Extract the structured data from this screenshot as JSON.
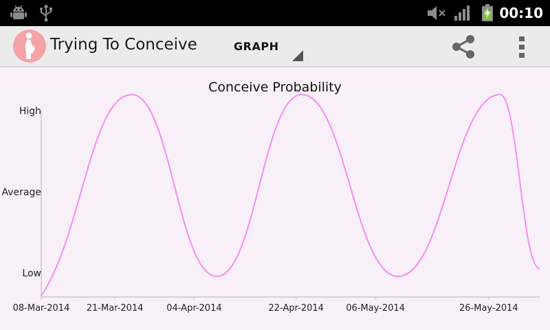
{
  "status_bar": {
    "clock": "00:10",
    "icons": [
      "android-debug-icon",
      "usb-icon",
      "volume-muted-icon",
      "signal-icon",
      "battery-charging-icon"
    ]
  },
  "action_bar": {
    "title": "Trying To Conceive",
    "logo_icon": "pregnant-woman-icon",
    "spinner_value": "GRAPH",
    "actions": [
      "share-icon",
      "overflow-menu-icon"
    ]
  },
  "colors": {
    "curve": "#f58ef0",
    "background": "#f7f0f6",
    "logo": "#f4a3a6"
  },
  "chart_data": {
    "type": "line",
    "title": "Conceive Probability",
    "y_categories": [
      "Low",
      "Average",
      "High"
    ],
    "x_tick_labels": [
      "08-Mar-2014",
      "21-Mar-2014",
      "04-Apr-2014",
      "22-Apr-2014",
      "06-May-2014",
      "26-May-2014"
    ],
    "x_range": [
      "08-Mar-2014",
      "04-Jun-2014"
    ],
    "y_range": [
      0,
      1
    ],
    "series": [
      {
        "points": [
          {
            "x": "08-Mar-2014",
            "y": -0.12
          },
          {
            "x": "24-Mar-2014",
            "y": 1.12
          },
          {
            "x": "08-Apr-2014",
            "y": 0.0
          },
          {
            "x": "23-Apr-2014",
            "y": 1.12
          },
          {
            "x": "10-May-2014",
            "y": 0.0
          },
          {
            "x": "28-May-2014",
            "y": 1.12
          },
          {
            "x": "04-Jun-2014",
            "y": 0.05
          }
        ]
      }
    ],
    "grid": false
  }
}
